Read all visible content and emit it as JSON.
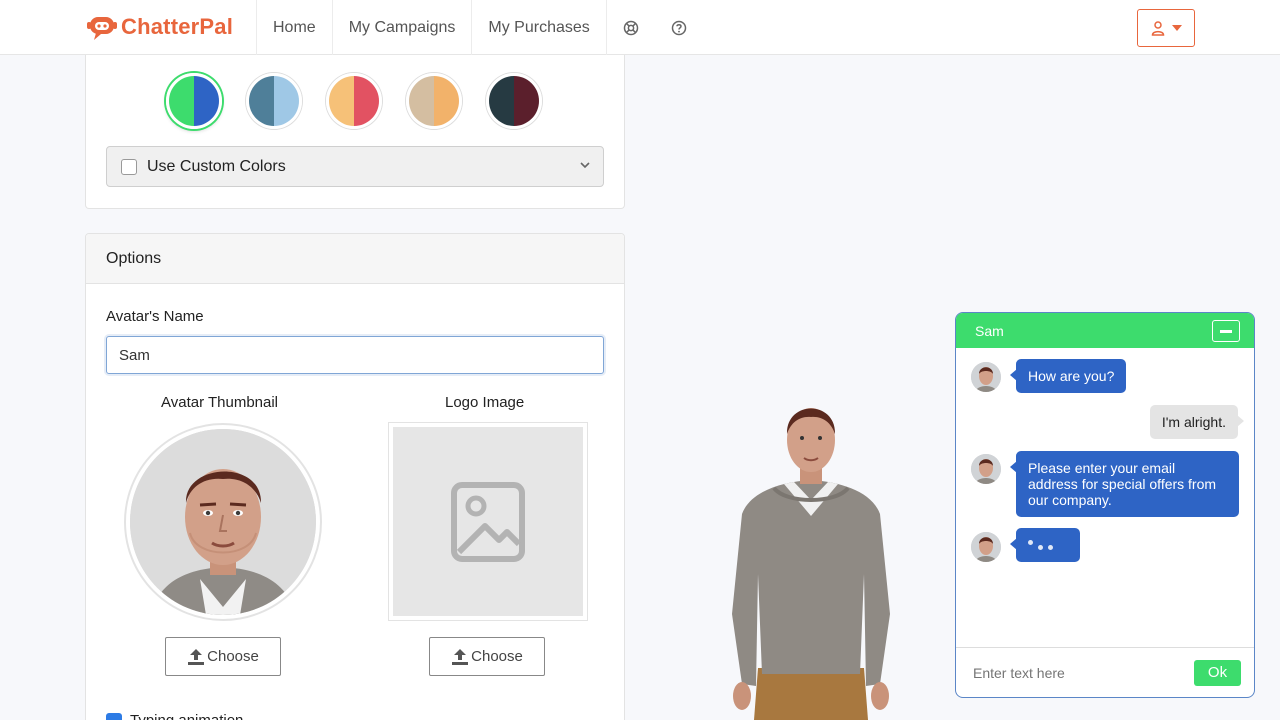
{
  "brand": {
    "name": "ChatterPal",
    "accent": "#e8663d"
  },
  "nav": {
    "items": [
      {
        "label": "Home"
      },
      {
        "label": "My Campaigns"
      },
      {
        "label": "My Purchases"
      }
    ],
    "icons": [
      "support-icon",
      "help-icon"
    ],
    "user_menu_icon": "user-icon"
  },
  "colors": {
    "swatches": [
      {
        "name": "green-blue",
        "left": "#3ddc6d",
        "right": "#2e64c5",
        "selected": true
      },
      {
        "name": "steel-skyblue",
        "left": "#4f7f99",
        "right": "#9fc8e6",
        "selected": false
      },
      {
        "name": "peach-red",
        "left": "#f6c178",
        "right": "#e25262",
        "selected": false
      },
      {
        "name": "tan-orange",
        "left": "#d4bea1",
        "right": "#f2b26a",
        "selected": false
      },
      {
        "name": "charcoal-maroon",
        "left": "#263a42",
        "right": "#5b1f2c",
        "selected": false
      }
    ],
    "custom_label": "Use Custom Colors",
    "custom_checked": false
  },
  "options": {
    "header": "Options",
    "name_label": "Avatar's Name",
    "name_value": "Sam",
    "thumbnail_label": "Avatar Thumbnail",
    "logo_label": "Logo Image",
    "choose_label": "Choose",
    "typing_label": "Typing animation",
    "typing_checked": true
  },
  "chat": {
    "title": "Sam",
    "header_color": "#3ddc6d",
    "bot_bubble_color": "#2e64c5",
    "messages": [
      {
        "from": "bot",
        "text": "How are you?"
      },
      {
        "from": "user",
        "text": "I'm alright."
      },
      {
        "from": "bot",
        "text": "Please enter your email address for special offers from our company."
      },
      {
        "from": "bot",
        "typing": true
      }
    ],
    "input_placeholder": "Enter text here",
    "send_label": "Ok"
  }
}
